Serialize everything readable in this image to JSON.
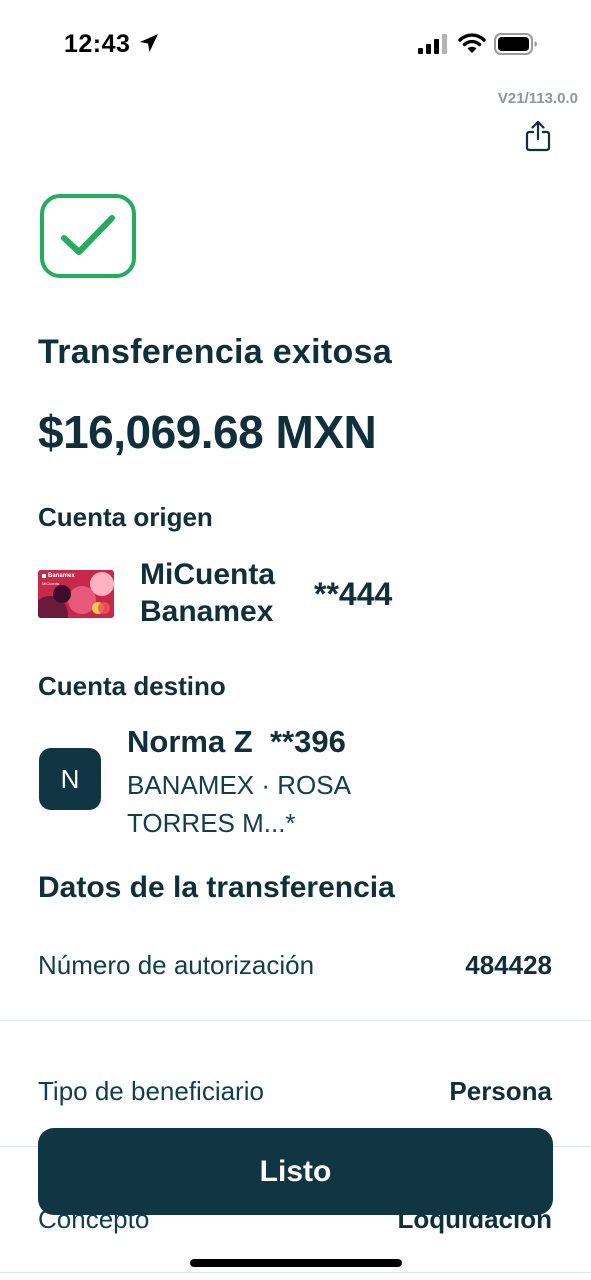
{
  "status_bar": {
    "time": "12:43"
  },
  "header": {
    "version": "V21/113.0.0",
    "share_icon": "share-icon"
  },
  "success": {
    "icon": "check-icon",
    "color": "#1fae5e"
  },
  "title": "Transferencia exitosa",
  "amount": "$16,069.68 MXN",
  "origin": {
    "label": "Cuenta origen",
    "account_name": "MiCuenta Banamex",
    "account_mask": "**444",
    "card_brand": "Banamex",
    "card_product": "MiCuenta"
  },
  "destination": {
    "label": "Cuenta destino",
    "avatar_initial": "N",
    "name": "Norma Z",
    "mask": "**396",
    "bank_line": "BANAMEX · ROSA TORRES M...*"
  },
  "details": {
    "heading": "Datos de la transferencia",
    "rows": [
      {
        "label": "Número de autorización",
        "value": "484428"
      },
      {
        "label": "Tipo de beneficiario",
        "value": "Persona"
      },
      {
        "label": "Concepto",
        "value": "Loquidación"
      }
    ]
  },
  "button": {
    "label": "Listo"
  },
  "colors": {
    "primary": "#0f3642",
    "text": "#0f2f3a",
    "success": "#1fae5e",
    "divider": "#e1e8ea"
  }
}
